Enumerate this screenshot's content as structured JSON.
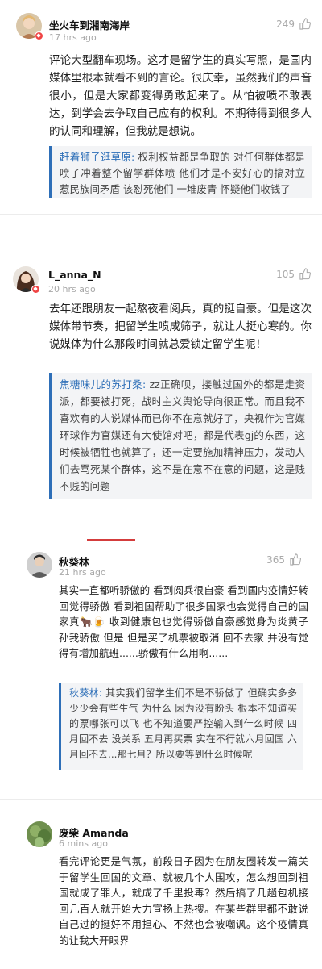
{
  "comments": [
    {
      "username": "坐火车到湘南海岸",
      "time": "17 hrs ago",
      "likes": "249",
      "text": "评论大型翻车现场。这才是留学生的真实写照，是国内媒体里根本就看不到的言论。很庆幸，虽然我们的声音很小，但是大家都变得勇敢起来了。从怕被喷不敢表达，到学会去争取自己应有的权利。不期待得到很多人的认同和理解，但我就是想说。",
      "reply_name": "赶着狮子逛草原:",
      "reply_text": " 权利权益都是争取的 对任何群体都是 喷子冲着整个留学群体喷 他们才是不安好心的搞对立 惹民族间矛盾 该怼死他们 一堆废青 怀疑他们收钱了"
    },
    {
      "username": "L_anna_N",
      "time": "20 hrs ago",
      "likes": "105",
      "text": "去年还跟朋友一起熬夜看阅兵，真的挺自豪。但是这次媒体带节奏，把留学生喷成筛子，就让人挺心寒的。你说媒体为什么那段时间就总爱锁定留学生呢！",
      "reply_name": "焦糖味儿的苏打桑:",
      "reply_text": " zz正确呗，接触过国外的都是走资派，都要被打死，战时主义舆论导向很正常。而且我不喜欢有的人说媒体而已你不在意就好了，央视作为官媒环球作为官媒还有大使馆对吧，都是代表gj的东西，这时候被牺牲也就算了，还一定要施加精神压力，发动人们去骂死某个群体，这不是在意不在意的问题，这是贱不贱的问题"
    },
    {
      "username": "秋葵林",
      "time": "21 hrs ago",
      "likes": "365",
      "text": "其实一直都听骄傲的 看到阅兵很自豪 看到国内疫情好转回觉得骄傲 看到祖国帮助了很多国家也会觉得自己的国家真🐂🍺 收到健康包也觉得骄傲自豪感觉身为炎黄子孙我骄傲 但是 但是买了机票被取消 回不去家 并没有觉得有增加航班......骄傲有什么用啊......",
      "reply_name": "秋葵林:",
      "reply_text": " 其实我们留学生们不是不骄傲了 但确实多多少少会有些生气 为什么 因为没有盼头 根本不知道买的票哪张可以飞 也不知道要严控输入到什么时候 四月回不去 没关系 五月再买票 实在不行就六月回国 六月回不去...那七月？所以要等到什么时候呢"
    },
    {
      "username": "废柴 Amanda",
      "time": "6 mins ago",
      "text": "看完评论更是气氛，前段日子因为在朋友圈转发一篇关于留学生回国的文章、就被几个人围攻，怎么想回到祖国就成了罪人，就成了千里投毒？然后搞了几趟包机接回几百人就开始大力宣扬上热搜。在某些群里都不敢说自己过的挺好不用担心、不然也会被嘲讽。这个疫情真的让我大开眼界"
    }
  ],
  "colors": {
    "quote_name": "#2e6fb8",
    "badge": "#f04444",
    "accent_line": "#d43c3c"
  },
  "icons": {
    "like": "thumbs-up-icon",
    "verified": "verified-badge-icon"
  }
}
